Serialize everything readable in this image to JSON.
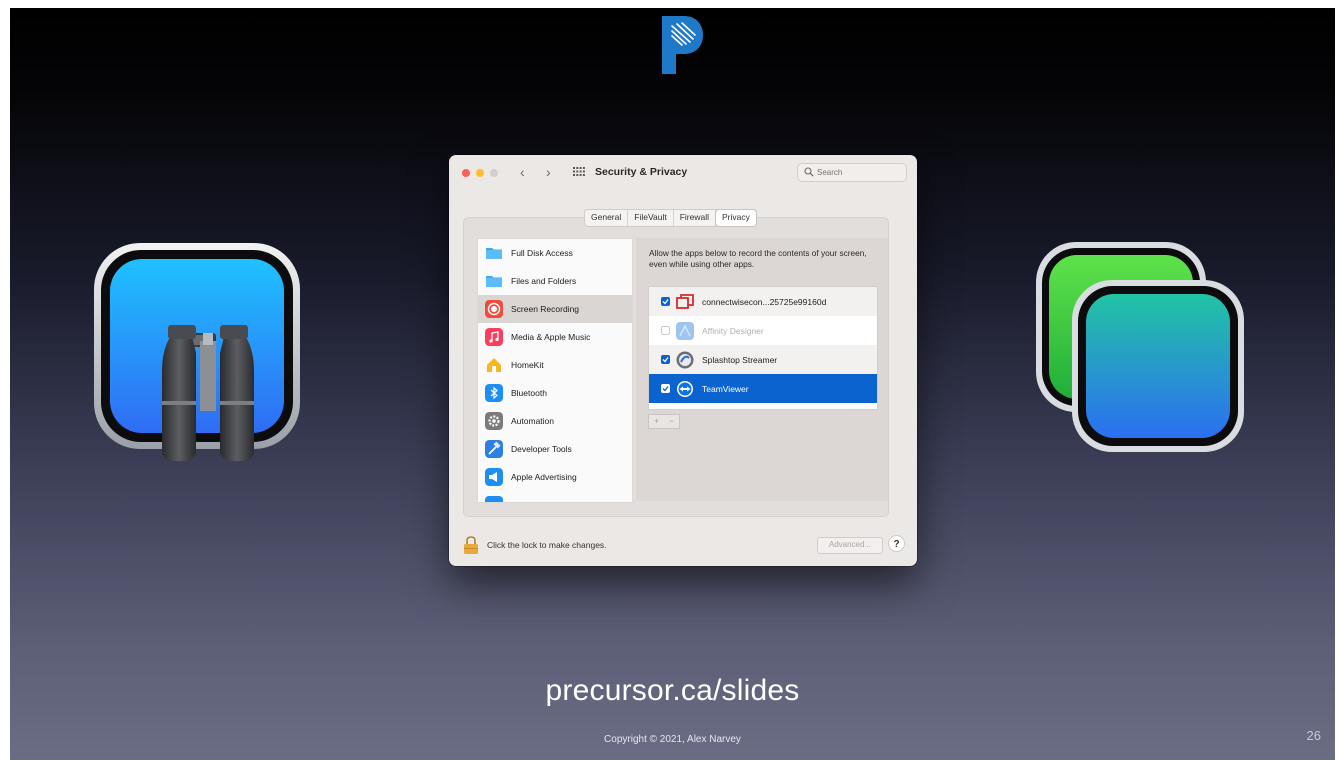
{
  "slide": {
    "url_text": "precursor.ca/slides",
    "copyright": "Copyright © 2021, Alex Narvey",
    "page_number": "26"
  },
  "window": {
    "title": "Security & Privacy",
    "search_placeholder": "Search",
    "back_symbol": "‹",
    "forward_symbol": "›",
    "tabs": [
      {
        "label": "General",
        "active": false
      },
      {
        "label": "FileVault",
        "active": false
      },
      {
        "label": "Firewall",
        "active": false
      },
      {
        "label": "Privacy",
        "active": true
      }
    ],
    "sidebar": [
      {
        "label": "Full Disk Access",
        "icon": "folder-icon",
        "selected": false
      },
      {
        "label": "Files and Folders",
        "icon": "folder-icon",
        "selected": false
      },
      {
        "label": "Screen Recording",
        "icon": "screen-recording-icon",
        "selected": true
      },
      {
        "label": "Media & Apple Music",
        "icon": "music-icon",
        "selected": false
      },
      {
        "label": "HomeKit",
        "icon": "home-icon",
        "selected": false
      },
      {
        "label": "Bluetooth",
        "icon": "bluetooth-icon",
        "selected": false
      },
      {
        "label": "Automation",
        "icon": "gear-icon",
        "selected": false
      },
      {
        "label": "Developer Tools",
        "icon": "hammer-icon",
        "selected": false
      },
      {
        "label": "Apple Advertising",
        "icon": "megaphone-icon",
        "selected": false
      }
    ],
    "description": "Allow the apps below to record the contents of your screen, even while using other apps.",
    "apps": [
      {
        "label": "connectwisecon...25725e99160d",
        "checked": true,
        "disabled": false,
        "selected": false,
        "icon": "connectwise-icon"
      },
      {
        "label": "Affinity Designer",
        "checked": false,
        "disabled": true,
        "selected": false,
        "icon": "affinity-designer-icon"
      },
      {
        "label": "Splashtop Streamer",
        "checked": true,
        "disabled": false,
        "selected": false,
        "icon": "splashtop-icon"
      },
      {
        "label": "TeamViewer",
        "checked": true,
        "disabled": false,
        "selected": true,
        "icon": "teamviewer-icon"
      }
    ],
    "add_symbol": "+",
    "remove_symbol": "−",
    "lock_text": "Click the lock to make changes.",
    "advanced_label": "Advanced...",
    "help_label": "?"
  },
  "colors": {
    "accent": "#0a63cf",
    "traffic_red": "#fe5f57",
    "traffic_yellow": "#febc2e"
  }
}
